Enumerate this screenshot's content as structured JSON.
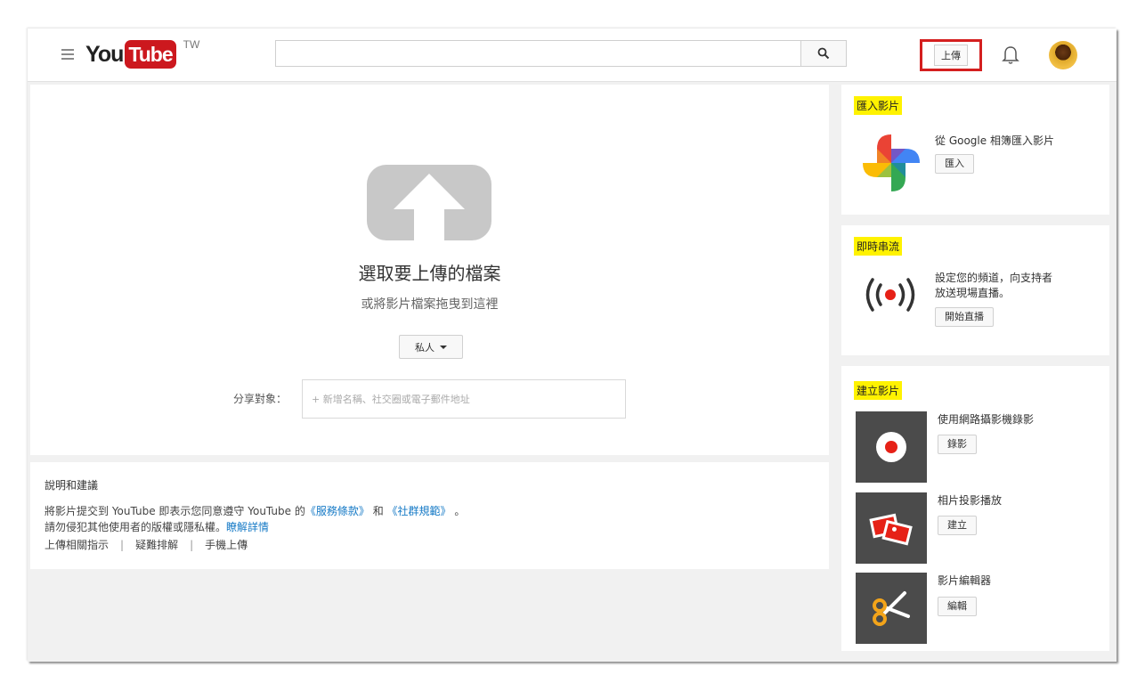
{
  "masthead": {
    "logo_you": "You",
    "logo_tube": "Tube",
    "logo_country": "TW",
    "search_placeholder": "",
    "upload_label": "上傳"
  },
  "upload": {
    "title": "選取要上傳的檔案",
    "drag_hint": "或將影片檔案拖曳到這裡",
    "privacy_value": "私人",
    "share_label": "分享對象：",
    "share_placeholder": "+ 新增名稱、社交圈或電子郵件地址"
  },
  "help": {
    "title": "說明和建議",
    "line1_prefix": "將影片提交到 YouTube 即表示您同意遵守 YouTube 的",
    "tos_link": "《服務條款》",
    "line1_and": "和",
    "guidelines_link": "《社群規範》",
    "line1_end": "。",
    "line2_prefix": "請勿侵犯其他使用者的版權或隱私權。",
    "learn_more": "瞭解詳情",
    "links": [
      "上傳相關指示",
      "疑難排解",
      "手機上傳"
    ],
    "separator": "|"
  },
  "import_card": {
    "title": "匯入影片",
    "text": "從 Google 相簿匯入影片",
    "button": "匯入"
  },
  "live_card": {
    "title": "即時串流",
    "text_line1": "設定您的頻道，向支持者",
    "text_line2": "放送現場直播。",
    "button": "開始直播"
  },
  "create_card": {
    "title": "建立影片",
    "items": [
      {
        "text": "使用網路攝影機錄影",
        "button": "錄影"
      },
      {
        "text": "相片投影播放",
        "button": "建立"
      },
      {
        "text": "影片編輯器",
        "button": "編輯"
      }
    ]
  }
}
